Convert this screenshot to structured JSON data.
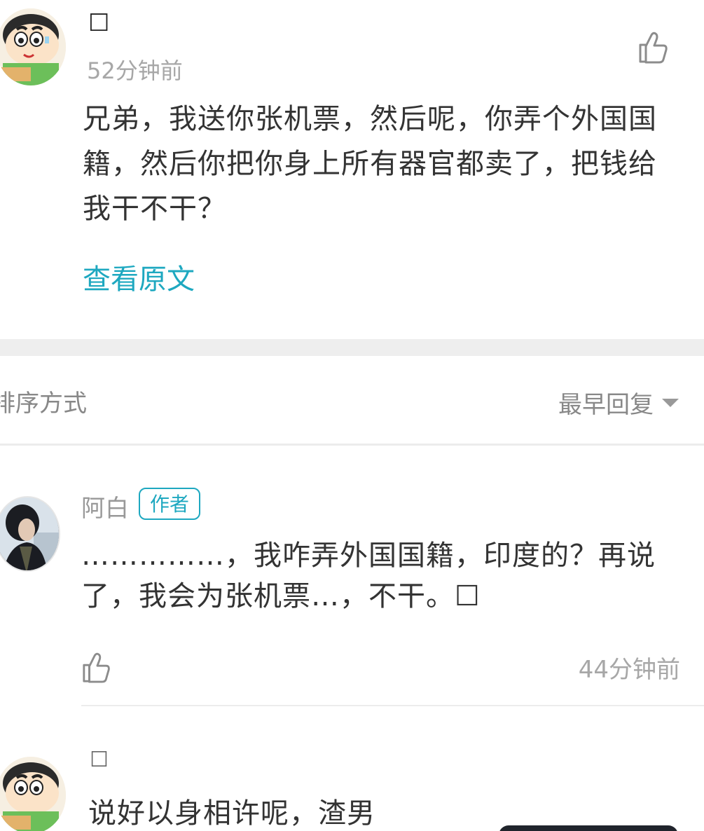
{
  "top_comment": {
    "username": "☐",
    "timestamp": "52分钟前",
    "body": "兄弟，我送你张机票，然后呢，你弄个外国国籍，然后你把你身上所有器官都卖了，把钱给我干不干？",
    "view_original": "查看原文",
    "like_icon": "thumbs-up-icon"
  },
  "sort_bar": {
    "label": "排序方式",
    "selected": "最早回复"
  },
  "reply": {
    "author": "阿白",
    "badge": "作者",
    "body": "……………，我咋弄外国国籍，印度的？再说了，我会为张机票…，不干。☐",
    "timestamp": "44分钟前",
    "like_icon": "thumbs-up-icon"
  },
  "reply2": {
    "username": "☐",
    "body": "说好以身相许呢，渣男"
  },
  "colors": {
    "accent": "#1ea8c0",
    "muted_text": "#a7a7a7",
    "body_text": "#333333",
    "section_gap": "#eeeeee"
  }
}
